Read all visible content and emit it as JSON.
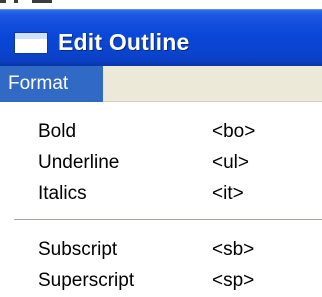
{
  "window": {
    "title": "Edit Outline",
    "icon": "window-icon"
  },
  "menubar": {
    "active_menu": "Format"
  },
  "dropdown": {
    "groups": [
      [
        {
          "label": "Bold",
          "shortcut": "<bo>"
        },
        {
          "label": "Underline",
          "shortcut": "<ul>"
        },
        {
          "label": "Italics",
          "shortcut": "<it>"
        }
      ],
      [
        {
          "label": "Subscript",
          "shortcut": "<sb>"
        },
        {
          "label": "Superscript",
          "shortcut": "<sp>"
        }
      ]
    ]
  },
  "colors": {
    "titlebar": "#0a47d8",
    "menu_highlight": "#316ac5",
    "menubar_bg": "#ece9d8",
    "separator": "#aca899"
  }
}
